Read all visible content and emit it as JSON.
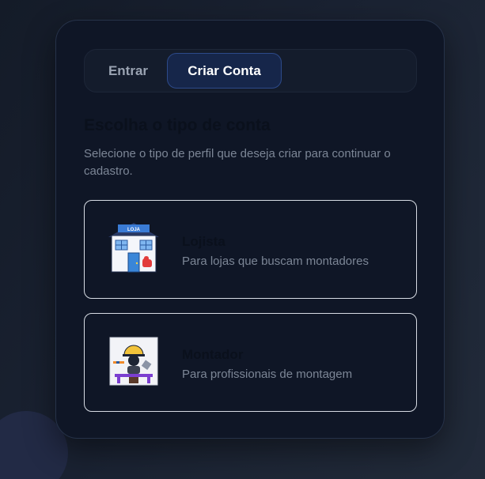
{
  "tabs": [
    {
      "label": "Entrar",
      "active": false
    },
    {
      "label": "Criar Conta",
      "active": true
    }
  ],
  "heading": "Escolha o tipo de conta",
  "subtitle": "Selecione o tipo de perfil que deseja criar para continuar o cadastro.",
  "options": [
    {
      "title": "Lojista",
      "description": "Para lojas que buscam montadores",
      "icon": "store-icon",
      "sign_text": "LOJA"
    },
    {
      "title": "Montador",
      "description": "Para profissionais de montagem",
      "icon": "assembler-icon"
    }
  ],
  "colors": {
    "accent": "#2d4a8a",
    "card_background": "#0f1626",
    "option_border": "#d7dce4"
  }
}
